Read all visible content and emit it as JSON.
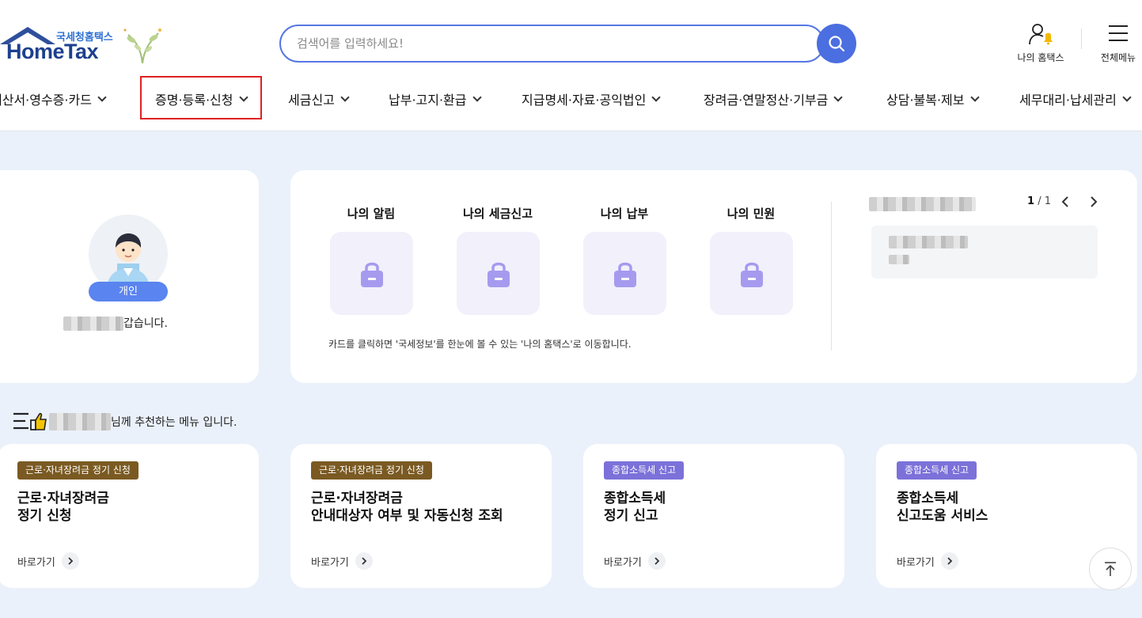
{
  "header": {
    "logo_small": "국세청홈택스",
    "logo_big": "HomeTax",
    "search_placeholder": "검색어를 입력하세요!",
    "my_hometax": "나의 홈택스",
    "all_menu": "전체메뉴"
  },
  "nav": {
    "items": [
      {
        "label": "계산서·영수증·카드"
      },
      {
        "label": "증명·등록·신청"
      },
      {
        "label": "세금신고"
      },
      {
        "label": "납부·고지·환급"
      },
      {
        "label": "지급명세·자료·공익법인"
      },
      {
        "label": "장려금·연말정산·기부금"
      },
      {
        "label": "상담·불복·제보"
      },
      {
        "label": "세무대리·납세관리"
      }
    ],
    "highlighted_index": 1,
    "highlight_color": "#e02020"
  },
  "profile": {
    "badge": "개인",
    "greeting_suffix": "갑습니다."
  },
  "summary": {
    "tiles": [
      {
        "label": "나의 알림"
      },
      {
        "label": "나의 세금신고"
      },
      {
        "label": "나의 납부"
      },
      {
        "label": "나의 민원"
      }
    ],
    "tile_icon": "lock-icon",
    "notice": "카드를 클릭하면 '국세정보'를 한눈에 볼 수 있는 '나의 홈택스'로 이동합니다.",
    "pager_current": "1",
    "pager_total": "/ 1"
  },
  "recommend": {
    "title_suffix": "님께 추천하는 메뉴 입니다."
  },
  "menu_cards": [
    {
      "tag": "근로·자녀장려금 정기 신청",
      "tag_color": "#7a5a22",
      "title1": "근로·자녀장려금",
      "title2": "정기 신청",
      "goto": "바로가기"
    },
    {
      "tag": "근로·자녀장려금 정기 신청",
      "tag_color": "#7a5a22",
      "title1": "근로·자녀장려금",
      "title2": "안내대상자 여부 및 자동신청 조회",
      "goto": "바로가기"
    },
    {
      "tag": "종합소득세 신고",
      "tag_color": "#7b71d9",
      "title1": "종합소득세",
      "title2": "정기 신고",
      "goto": "바로가기"
    },
    {
      "tag": "종합소득세 신고",
      "tag_color": "#7b71d9",
      "title1": "종합소득세",
      "title2": "신고도움 서비스",
      "goto": "바로가기"
    }
  ],
  "colors": {
    "accent": "#4b6ee0",
    "background": "#eaf1fb"
  }
}
